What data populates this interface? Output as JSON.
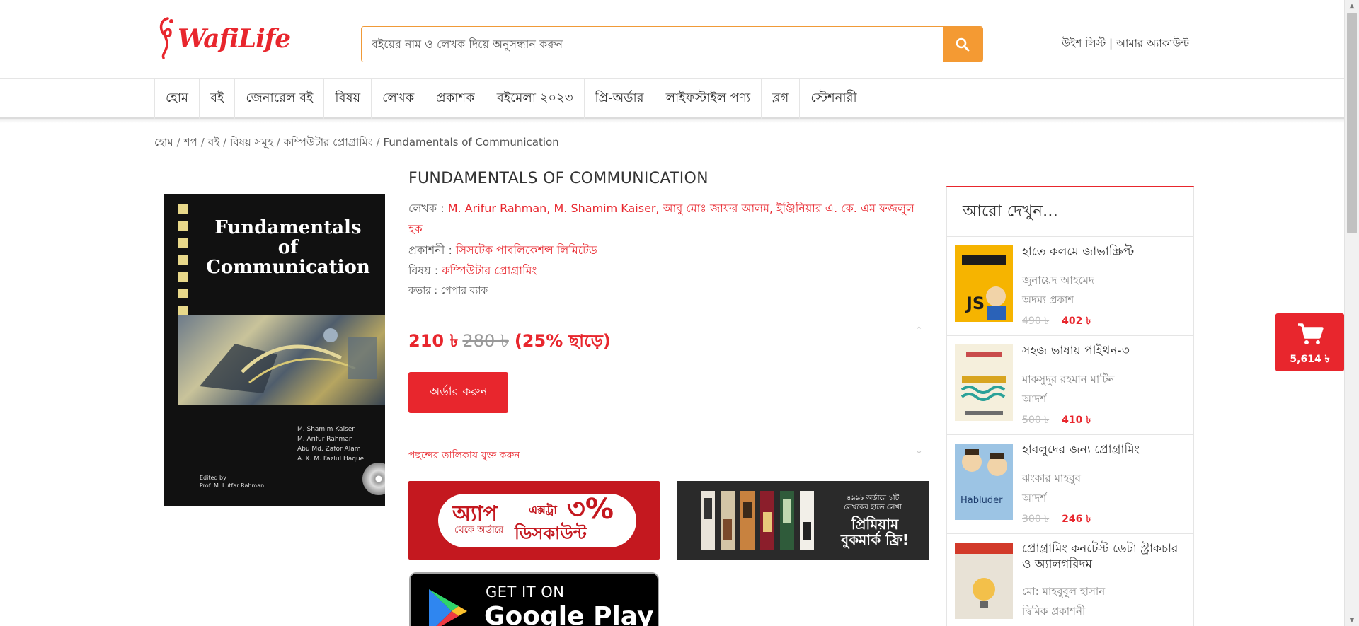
{
  "header": {
    "logo_text": "WafiLife",
    "search_placeholder": "বইয়ের নাম ও লেখক দিয়ে অনুসন্ধান করুন",
    "wishlist_label": "উইশ লিস্ট",
    "account_label": "আমার অ্যাকাউন্ট",
    "links_separator": "|",
    "accent_color": "#e8262d",
    "search_button_color": "#f49a33"
  },
  "nav": {
    "items": [
      "হোম",
      "বই",
      "জেনারেল বই",
      "বিষয়",
      "লেখক",
      "প্রকাশক",
      "বইমেলা ২০২৩",
      "প্রি-অর্ডার",
      "লাইফস্টাইল পণ্য",
      "ব্লগ",
      "স্টেশনারী"
    ]
  },
  "breadcrumb": {
    "items": [
      "হোম",
      "শপ",
      "বই",
      "বিষয় সমূহ",
      "কম্পিউটার প্রোগ্রামিং",
      "Fundamentals of Communication"
    ],
    "separator": "/"
  },
  "cover": {
    "title_line1": "Fundamentals",
    "title_line2": "of",
    "title_line3": "Communication",
    "authors": [
      "M. Shamim Kaiser",
      "M. Arifur Rahman",
      "Abu Md. Zafor Alam",
      "A. K. M. Fazlul Haque"
    ],
    "editor_line1": "Edited by",
    "editor_line2": "Prof. M. Lutfar Rahman"
  },
  "product": {
    "title": "FUNDAMENTALS OF COMMUNICATION",
    "author_label": "লেখক :",
    "authors_line1": "M. Arifur Rahman, M. Shamim Kaiser, আবু মোঃ জাফর আলম, ইঞ্জিনিয়ার এ. কে. এম ফজলুল",
    "authors_line2": "হক",
    "publisher_label": "প্রকাশনী :",
    "publisher": "সিসটেক পাবলিকেশন্স লিমিটেড",
    "subject_label": "বিষয় :",
    "subject": "কম্পিউটার প্রোগ্রামিং",
    "cover_type": "কভার : পেপার ব্যাক",
    "price": "210 ৳",
    "old_price": "280 ৳",
    "discount": "(25% ছাড়ে)",
    "order_button": "অর্ডার করুন",
    "wishlist_link": "পছন্দের তালিকায় যুক্ত করুন"
  },
  "banners": {
    "app_discount": {
      "app_text": "অ্যাপ",
      "sub_text": "থেকে অর্ডারে",
      "extra_text": "এক্সট্রা",
      "percent_text": "৩%",
      "discount_text": "ডিসকাউন্ট"
    },
    "bookmark": {
      "small_text": "৪৯৯৳ অর্ডারে ১টি লেখকের হাতে লেখা",
      "big_text": "প্রিমিয়াম বুকমার্ক ফ্রি!"
    },
    "google_play": {
      "small_text": "GET IT ON",
      "big_text": "Google Play"
    }
  },
  "sidebar": {
    "title": "আরো দেখুন...",
    "items": [
      {
        "title": "হাতে কলমে জাভাস্ক্রিপ্ট",
        "author": "জুনায়েদ আহমেদ",
        "publisher": "অদম্য প্রকাশ",
        "old_price": "490 ৳",
        "price": "402 ৳"
      },
      {
        "title": "সহজ ভাষায় পাইথন-৩",
        "author": "মাকসুদুর রহমান মাটিন",
        "publisher": "আদর্শ",
        "old_price": "500 ৳",
        "price": "410 ৳"
      },
      {
        "title": "হাবলুদের জন্য প্রোগ্রামিং",
        "author": "ঝংকার মাহবুব",
        "publisher": "আদর্শ",
        "old_price": "300 ৳",
        "price": "246 ৳"
      },
      {
        "title": "প্রোগ্রামিং কনটেস্ট ডেটা স্ট্রাকচার ও অ্যালগরিদম",
        "author": "মো: মাহবুবুল হাসান",
        "publisher": "দ্বিমিক প্রকাশনী",
        "old_price": "",
        "price": ""
      }
    ]
  },
  "cart": {
    "amount": "5,614 ৳"
  }
}
